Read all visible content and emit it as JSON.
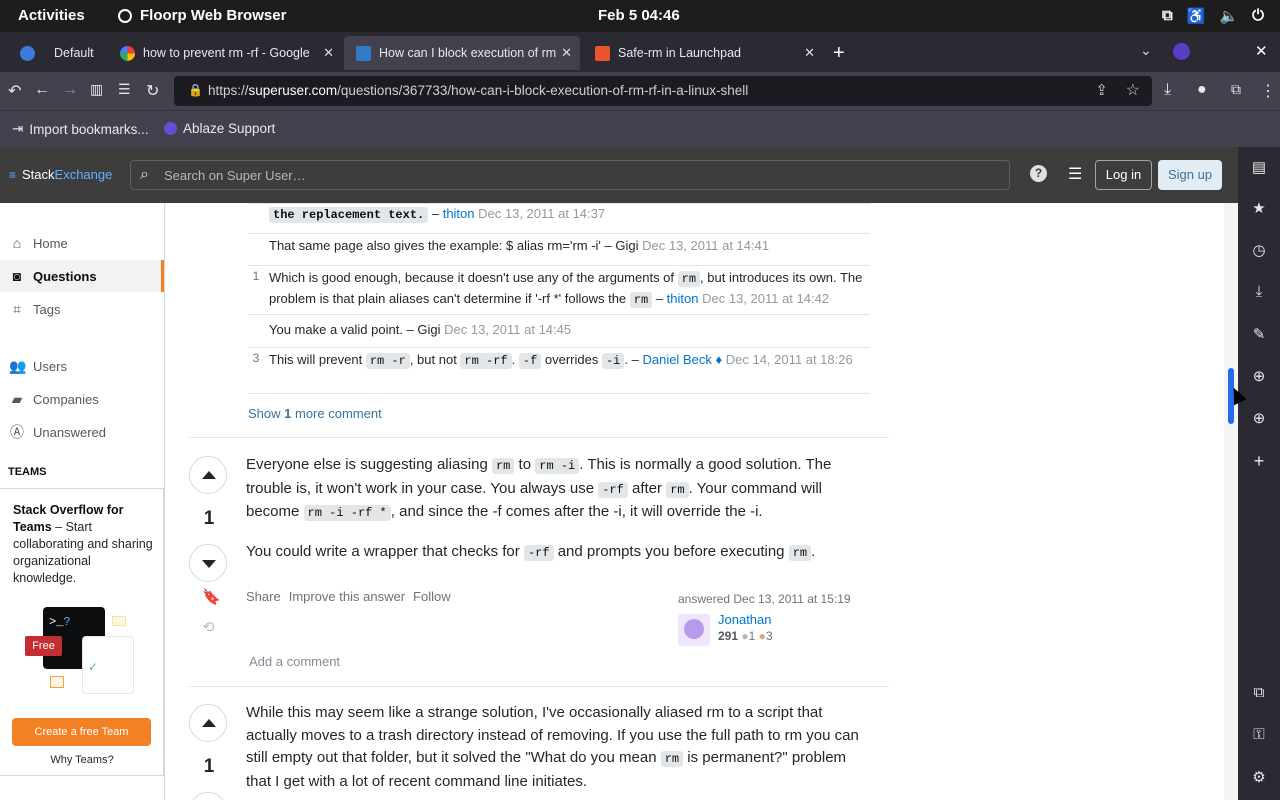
{
  "system": {
    "activities": "Activities",
    "app_name": "Floorp Web Browser",
    "clock": "Feb 5  04:46"
  },
  "tabs": [
    {
      "label": "Default"
    },
    {
      "label": "how to prevent rm -rf - Google Se"
    },
    {
      "label": "How can I block execution of rm -"
    },
    {
      "label": "Safe-rm in Launchpad"
    }
  ],
  "url": {
    "prefix": "https://",
    "host": "superuser.com",
    "path": "/questions/367733/how-can-i-block-execution-of-rm-rf-in-a-linux-shell"
  },
  "bookmarks": [
    {
      "label": "Import bookmarks..."
    },
    {
      "label": "Ablaze Support"
    }
  ],
  "se_header": {
    "logo_a": "Stack",
    "logo_b": "Exchange",
    "search_placeholder": "Search on Super User…",
    "login": "Log in",
    "signup": "Sign up"
  },
  "left_nav": {
    "home": "Home",
    "questions": "Questions",
    "tags": "Tags",
    "users": "Users",
    "companies": "Companies",
    "unanswered": "Unanswered",
    "teams_heading": "TEAMS",
    "teams_title": "Stack Overflow for Teams",
    "teams_desc": " – Start collaborating and sharing organizational knowledge.",
    "free_badge": "Free",
    "cta": "Create a free Team",
    "why": "Why Teams?"
  },
  "comments": [
    {
      "score": "",
      "code": "the replacement text.",
      "sep": " – ",
      "user": "thiton",
      "date": "Dec 13, 2011 at 14:37"
    },
    {
      "score": "",
      "text": "That same page also gives the example: $ alias rm='rm -i' – Gigi",
      "date": "Dec 13, 2011 at 14:41"
    },
    {
      "score": "1",
      "text1": "Which is good enough, because it doesn't use any of the arguments of ",
      "code1": "rm",
      "text2": ", but introduces its own. The problem is that plain aliases can't determine if '-rf *' follows the ",
      "code2": "rm",
      "sep": " – ",
      "user": "thiton",
      "date": "Dec 13, 2011 at 14:42"
    },
    {
      "score": "",
      "text": "You make a valid point. – Gigi",
      "date": "Dec 13, 2011 at 14:45"
    },
    {
      "score": "3",
      "text1": "This will prevent ",
      "code1": "rm -r",
      "text2": ", but not ",
      "code2": "rm -rf",
      "text3": ". ",
      "code3": "-f",
      "text4": " overrides ",
      "code4": "-i",
      "text5": ". – ",
      "user": "Daniel Beck",
      "mod": "♦",
      "date": "Dec 14, 2011 at 18:26"
    }
  ],
  "show_more": {
    "pre": "Show ",
    "count": "1",
    "post": " more comment"
  },
  "answer1": {
    "score": "1",
    "p1_a": "Everyone else is suggesting aliasing ",
    "p1_c1": "rm",
    "p1_b": " to ",
    "p1_c2": "rm -i",
    "p1_c": ". This is normally a good solution. The trouble is, it won't work in your case. You always use ",
    "p1_c3": "-rf",
    "p1_d": " after ",
    "p1_c4": "rm",
    "p1_e": ". Your command will become ",
    "p1_c5": "rm -i -rf *",
    "p1_f": ", and since the -f comes after the -i, it will override the -i.",
    "p2_a": "You could write a wrapper that checks for ",
    "p2_c1": "-rf",
    "p2_b": " and prompts you before executing ",
    "p2_c2": "rm",
    "p2_c": ".",
    "share": "Share",
    "improve": "Improve this answer",
    "follow": "Follow",
    "answered": "answered Dec 13, 2011 at 15:19",
    "user": "Jonathan",
    "rep": "291",
    "silver": "1",
    "bronze": "3",
    "add_comment": "Add a comment"
  },
  "answer2": {
    "score": "1",
    "p1_a": "While this may seem like a strange solution, I've occasionally aliased rm to a script that actually moves to a trash directory instead of removing. If you use the full path to rm you can still empty out that folder, but it solved the \"What do you mean ",
    "p1_c1": "rm",
    "p1_b": " is permanent?\" problem that I get with a lot of recent command line initiates."
  }
}
